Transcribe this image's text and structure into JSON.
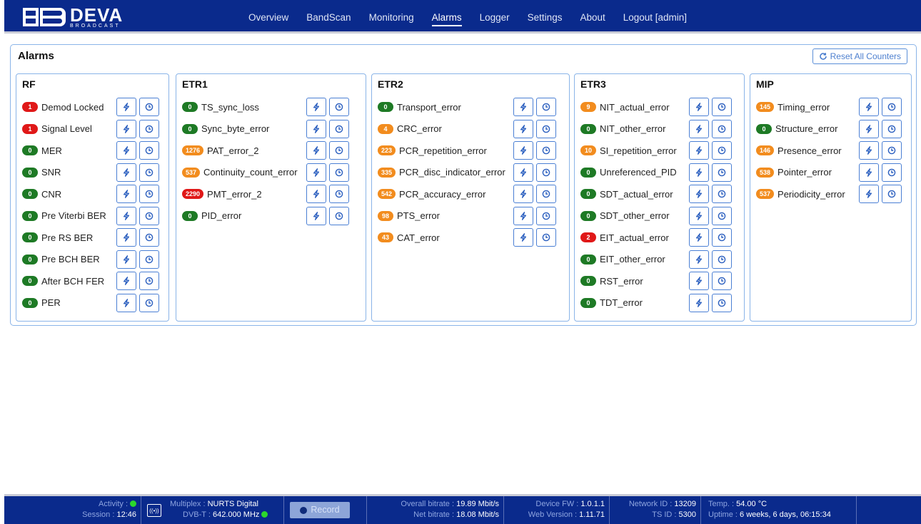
{
  "header": {
    "logo_text": "DEVA",
    "logo_sub": "BROADCAST",
    "nav": [
      "Overview",
      "BandScan",
      "Monitoring",
      "Alarms",
      "Logger",
      "Settings",
      "About",
      "Logout [admin]"
    ],
    "active_nav": "Alarms"
  },
  "page": {
    "title": "Alarms",
    "reset_label": "Reset All Counters"
  },
  "groups": {
    "rf": {
      "title": "RF",
      "items": [
        {
          "label": "Demod Locked",
          "count": "1",
          "status": "red"
        },
        {
          "label": "Signal Level",
          "count": "1",
          "status": "red"
        },
        {
          "label": "MER",
          "count": "0",
          "status": "green"
        },
        {
          "label": "SNR",
          "count": "0",
          "status": "green"
        },
        {
          "label": "CNR",
          "count": "0",
          "status": "green"
        },
        {
          "label": "Pre Viterbi BER",
          "count": "0",
          "status": "green"
        },
        {
          "label": "Pre RS BER",
          "count": "0",
          "status": "green"
        },
        {
          "label": "Pre BCH BER",
          "count": "0",
          "status": "green"
        },
        {
          "label": "After BCH FER",
          "count": "0",
          "status": "green"
        },
        {
          "label": "PER",
          "count": "0",
          "status": "green"
        }
      ]
    },
    "etr1": {
      "title": "ETR1",
      "items": [
        {
          "label": "TS_sync_loss",
          "count": "0",
          "status": "green"
        },
        {
          "label": "Sync_byte_error",
          "count": "0",
          "status": "green"
        },
        {
          "label": "PAT_error_2",
          "count": "1276",
          "status": "orange"
        },
        {
          "label": "Continuity_count_error",
          "count": "537",
          "status": "orange"
        },
        {
          "label": "PMT_error_2",
          "count": "2290",
          "status": "red"
        },
        {
          "label": "PID_error",
          "count": "0",
          "status": "green"
        }
      ]
    },
    "etr2": {
      "title": "ETR2",
      "items": [
        {
          "label": "Transport_error",
          "count": "0",
          "status": "green"
        },
        {
          "label": "CRC_error",
          "count": "4",
          "status": "orange"
        },
        {
          "label": "PCR_repetition_error",
          "count": "223",
          "status": "orange"
        },
        {
          "label": "PCR_disc_indicator_error",
          "count": "335",
          "status": "orange"
        },
        {
          "label": "PCR_accuracy_error",
          "count": "542",
          "status": "orange"
        },
        {
          "label": "PTS_error",
          "count": "98",
          "status": "orange"
        },
        {
          "label": "CAT_error",
          "count": "43",
          "status": "orange"
        }
      ]
    },
    "etr3": {
      "title": "ETR3",
      "items": [
        {
          "label": "NIT_actual_error",
          "count": "9",
          "status": "orange"
        },
        {
          "label": "NIT_other_error",
          "count": "0",
          "status": "green"
        },
        {
          "label": "SI_repetition_error",
          "count": "10",
          "status": "orange"
        },
        {
          "label": "Unreferenced_PID",
          "count": "0",
          "status": "green"
        },
        {
          "label": "SDT_actual_error",
          "count": "0",
          "status": "green"
        },
        {
          "label": "SDT_other_error",
          "count": "0",
          "status": "green"
        },
        {
          "label": "EIT_actual_error",
          "count": "2",
          "status": "red"
        },
        {
          "label": "EIT_other_error",
          "count": "0",
          "status": "green"
        },
        {
          "label": "RST_error",
          "count": "0",
          "status": "green"
        },
        {
          "label": "TDT_error",
          "count": "0",
          "status": "green"
        }
      ]
    },
    "mip": {
      "title": "MIP",
      "items": [
        {
          "label": "Timing_error",
          "count": "145",
          "status": "orange"
        },
        {
          "label": "Structure_error",
          "count": "0",
          "status": "green"
        },
        {
          "label": "Presence_error",
          "count": "146",
          "status": "orange"
        },
        {
          "label": "Pointer_error",
          "count": "538",
          "status": "orange"
        },
        {
          "label": "Periodicity_error",
          "count": "537",
          "status": "orange"
        }
      ]
    }
  },
  "status_colors": {
    "green": "#1e7a25",
    "red": "#e01818",
    "orange": "#f28c1e"
  },
  "statusbar": {
    "activity_label": "Activity :",
    "session_label": "Session :",
    "session_value": "12:46",
    "multiplex_label": "Multiplex :",
    "multiplex_value": "NURTS Digital",
    "dvbt_label": "DVB-T :",
    "dvbt_value": "642.000 MHz",
    "record_label": "Record",
    "overall_bitrate_label": "Overall bitrate :",
    "overall_bitrate_value": "19.89 Mbit/s",
    "net_bitrate_label": "Net bitrate :",
    "net_bitrate_value": "18.08 Mbit/s",
    "device_fw_label": "Device FW :",
    "device_fw_value": "1.0.1.1",
    "web_version_label": "Web Version :",
    "web_version_value": "1.11.71",
    "network_id_label": "Network ID :",
    "network_id_value": "13209",
    "ts_id_label": "TS ID :",
    "ts_id_value": "5300",
    "temp_label": "Temp. :",
    "temp_value": "54.00 °C",
    "uptime_label": "Uptime :",
    "uptime_value": "6 weeks, 6 days, 06:15:34"
  }
}
